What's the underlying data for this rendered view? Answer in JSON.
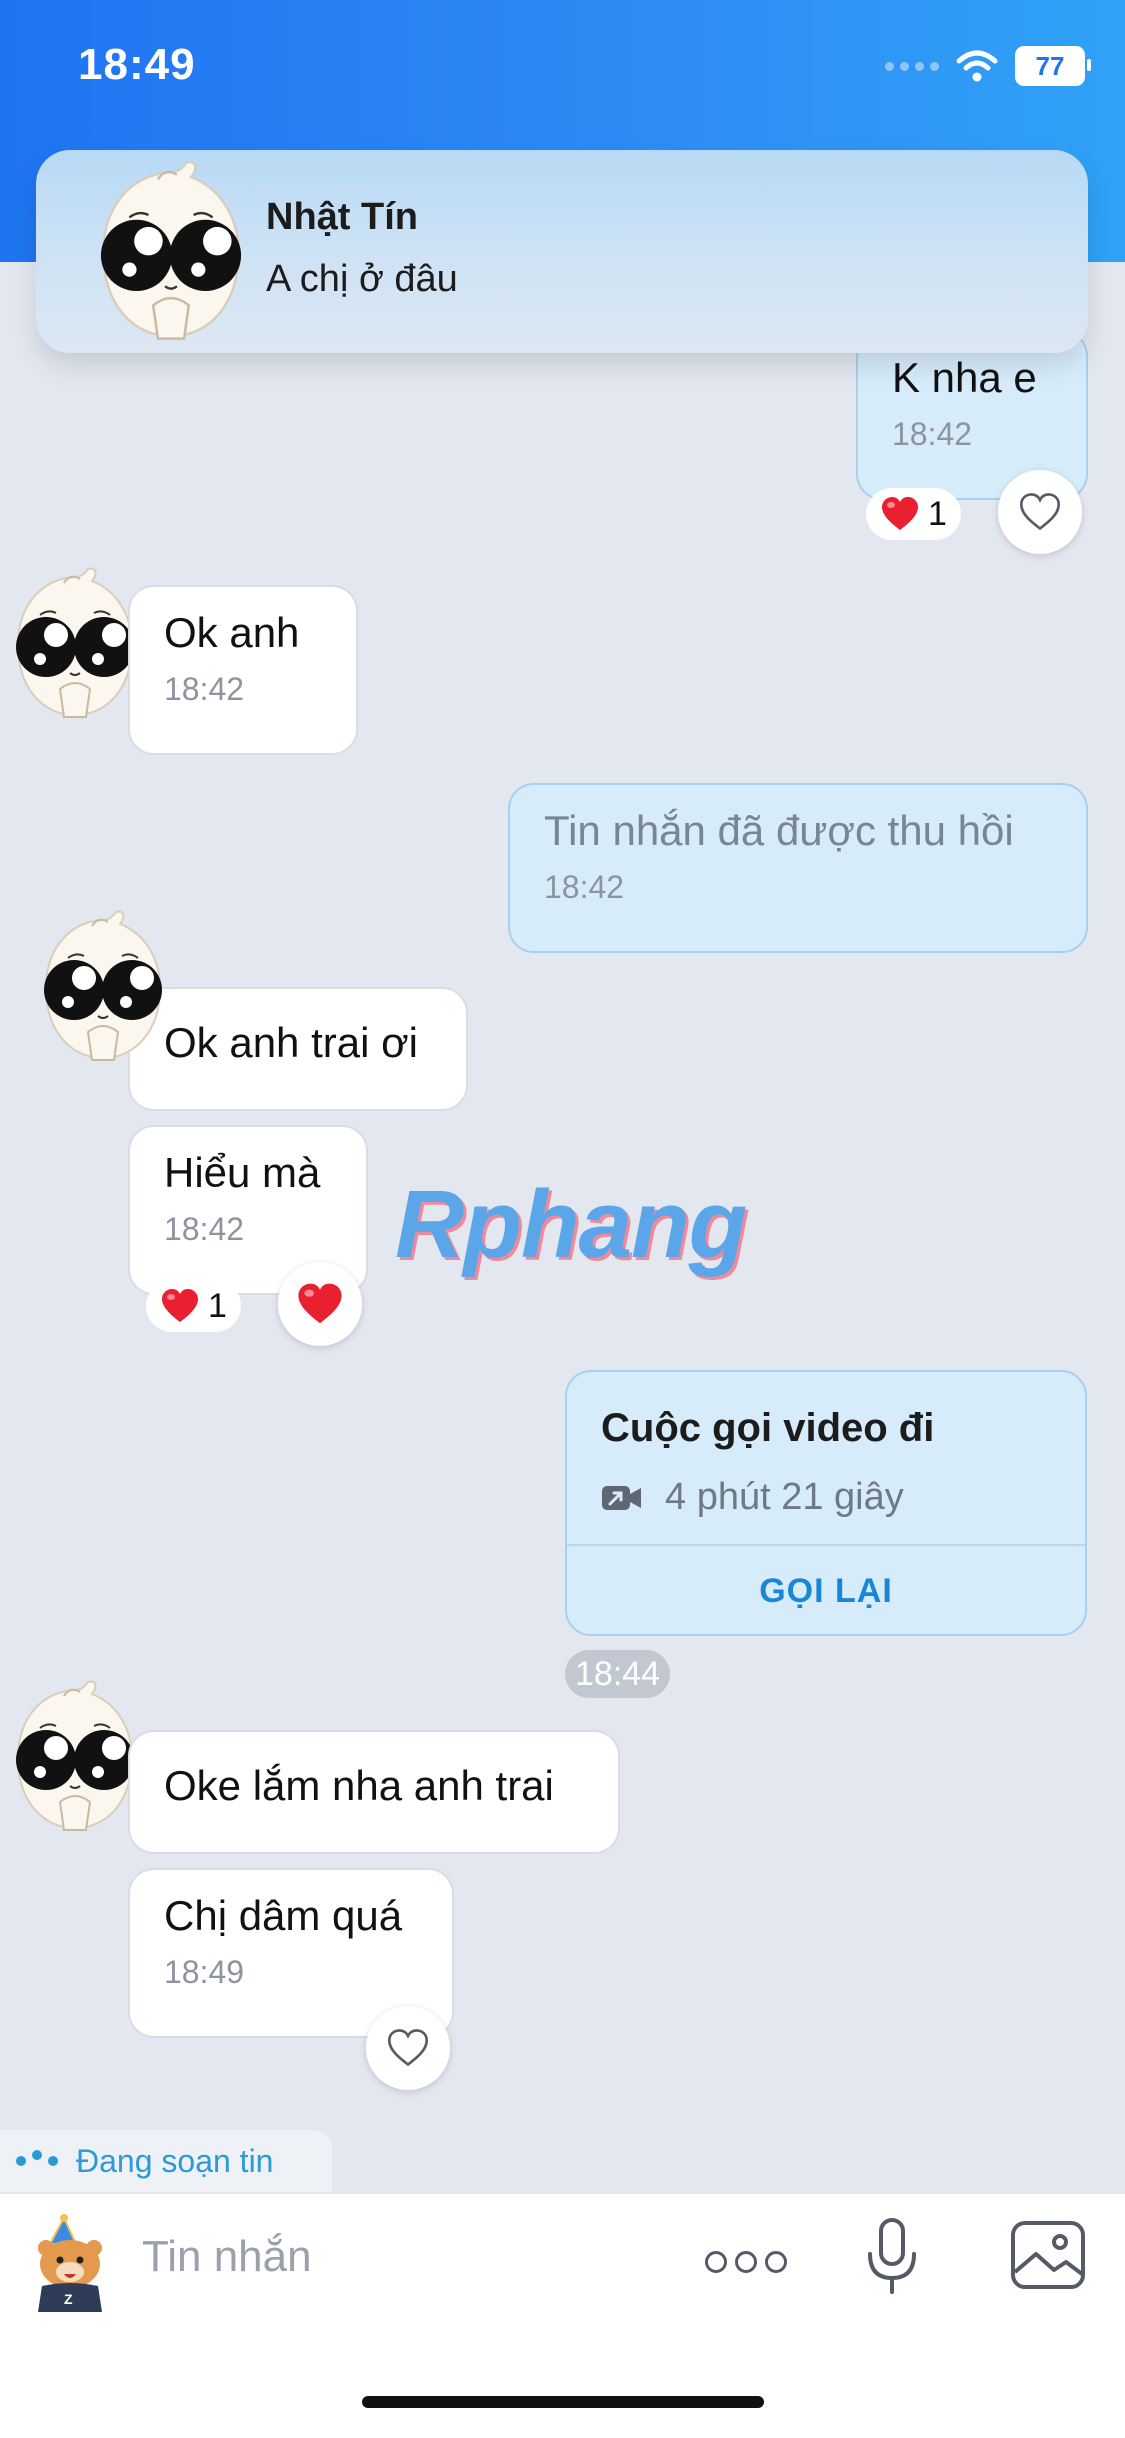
{
  "status_bar": {
    "time": "18:49",
    "battery": "77"
  },
  "notification": {
    "name": "Nhật Tín",
    "message": "A chị ở đâu"
  },
  "messages": [
    {
      "dir": "out",
      "text": "K nha e",
      "time": "18:42",
      "reaction_count": "1"
    },
    {
      "dir": "in",
      "text": "Ok anh",
      "time": "18:42"
    },
    {
      "dir": "out",
      "text": "Tin nhắn đã được thu hồi",
      "time": "18:42",
      "recalled": true
    },
    {
      "dir": "in",
      "text": "Ok anh trai ơi"
    },
    {
      "dir": "in",
      "text": "Hiểu mà",
      "time": "18:42",
      "reaction_count": "1"
    },
    {
      "dir": "in",
      "text": "Oke lắm nha anh trai"
    },
    {
      "dir": "in",
      "text": "Chị dâm quá",
      "time": "18:49"
    }
  ],
  "call_card": {
    "title": "Cuộc gọi video đi",
    "duration": "4 phút 21 giây",
    "action": "GỌI LẠI",
    "time": "18:44"
  },
  "typing_indicator": "Đang soạn tin",
  "composer": {
    "placeholder": "Tin nhắn"
  },
  "watermark": "Rphang",
  "colors": {
    "header_gradient": [
      "#1f74f2",
      "#2fa2f6"
    ],
    "background": "#e3e7f0",
    "outgoing_bubble": "#d6ecfb",
    "accent": "#1a86d6",
    "heart": "#e8202f"
  }
}
